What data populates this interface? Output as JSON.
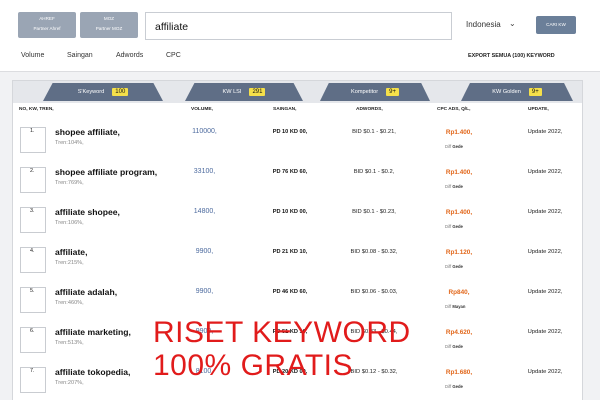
{
  "partners": [
    {
      "name": "AHREF",
      "sub": "Partner Ahref"
    },
    {
      "name": "MOZ",
      "sub": "Partner MOZ"
    }
  ],
  "search": {
    "value": "affiliate"
  },
  "country": {
    "selected": "Indonesia"
  },
  "cari_button": "CARI KW",
  "nav": {
    "items": [
      "Volume",
      "Saingan",
      "Adwords",
      "CPC"
    ],
    "export": "EXPORT SEMUA (100) KEYWORD"
  },
  "tabs": [
    {
      "label": "S'Keyword",
      "count": "100"
    },
    {
      "label": "KW LSI",
      "count": "291"
    },
    {
      "label": "Kompetitor",
      "count": "9+"
    },
    {
      "label": "KW Golden",
      "count": "9+"
    }
  ],
  "table": {
    "headers": [
      "NO, KW, TREN,",
      "VOLUME,",
      "SAINGAN,",
      "ADWORDS,",
      "CPC ADS, Q/L,",
      "UPDATE,"
    ],
    "rows": [
      {
        "no": "1.",
        "keyword": "shopee affiliate,",
        "trend": "Tren:104%,",
        "volume": "110000,",
        "saingan": "PD 10 KD 00,",
        "adwords": "BID $0.1 - $0.21,",
        "cpc": "Rp1.400,",
        "diff_label": "Diff",
        "diff": "Gede",
        "update": "Update 2022,"
      },
      {
        "no": "2.",
        "keyword": "shopee affiliate program,",
        "trend": "Tren:769%,",
        "volume": "33100,",
        "saingan": "PD 76 KD 60,",
        "adwords": "BID $0.1 - $0.2,",
        "cpc": "Rp1.400,",
        "diff_label": "Diff",
        "diff": "Gede",
        "update": "Update 2022,"
      },
      {
        "no": "3.",
        "keyword": "affiliate shopee,",
        "trend": "Tren:106%,",
        "volume": "14800,",
        "saingan": "PD 10 KD 00,",
        "adwords": "BID $0.1 - $0.23,",
        "cpc": "Rp1.400,",
        "diff_label": "Diff",
        "diff": "Gede",
        "update": "Update 2022,"
      },
      {
        "no": "4.",
        "keyword": "affiliate,",
        "trend": "Tren:215%,",
        "volume": "9900,",
        "saingan": "PD 21 KD 10,",
        "adwords": "BID $0.08 - $0.32,",
        "cpc": "Rp1.120,",
        "diff_label": "Diff",
        "diff": "Gede",
        "update": "Update 2022,"
      },
      {
        "no": "5.",
        "keyword": "affiliate adalah,",
        "trend": "Tren:460%,",
        "volume": "9900,",
        "saingan": "PD 46 KD 60,",
        "adwords": "BID $0.06 - $0.03,",
        "cpc": "Rp840,",
        "diff_label": "Diff",
        "diff": "Mayan",
        "update": "Update 2022,"
      },
      {
        "no": "6.",
        "keyword": "affiliate marketing,",
        "trend": "Tren:513%,",
        "volume": "9900,",
        "saingan": "PD 51 KD 10,",
        "adwords": "BID $0.33 - $0.44,",
        "cpc": "Rp4.620,",
        "diff_label": "Diff",
        "diff": "Gede",
        "update": "Update 2022,"
      },
      {
        "no": "7.",
        "keyword": "affiliate tokopedia,",
        "trend": "Tren:207%,",
        "volume": "8100,",
        "saingan": "PD 20 KD 00,",
        "adwords": "BID $0.12 - $0.32,",
        "cpc": "Rp1.680,",
        "diff_label": "Diff",
        "diff": "Gede",
        "update": "Update 2022,"
      }
    ]
  },
  "overlay": {
    "line1": "RISET KEYWORD",
    "line2": "100% GRATIS"
  },
  "colors": {
    "accent": "#5f6e86",
    "cpc": "#e2681c",
    "volume": "#4c6a9e",
    "overlay": "#e11b1b",
    "badge": "#f5e04a"
  }
}
